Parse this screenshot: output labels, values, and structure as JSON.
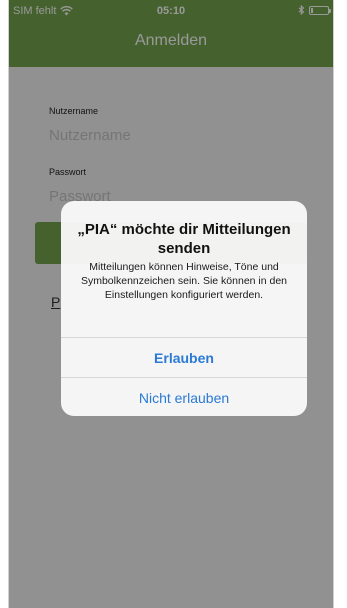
{
  "status_bar": {
    "carrier": "SIM fehlt",
    "time": "05:10",
    "wifi_icon": "wifi-icon",
    "bluetooth_icon": "bluetooth-icon",
    "battery_icon": "battery-icon",
    "battery_level": 0.1
  },
  "header": {
    "title": "Anmelden",
    "color": "#73a24c"
  },
  "form": {
    "username_label": "Nutzername",
    "username_placeholder": "Nutzername",
    "password_label": "Passwort",
    "password_placeholder": "Passwort",
    "link_fragment": "P"
  },
  "alert": {
    "title": "„PIA“ möchte dir Mitteilungen senden",
    "message": "Mitteilungen können Hinweise, Töne und Symbolkennzeichen sein. Sie können in den Einstellungen konfiguriert werden.",
    "allow_label": "Erlauben",
    "deny_label": "Nicht erlauben",
    "action_color": "#2a7ad6"
  }
}
